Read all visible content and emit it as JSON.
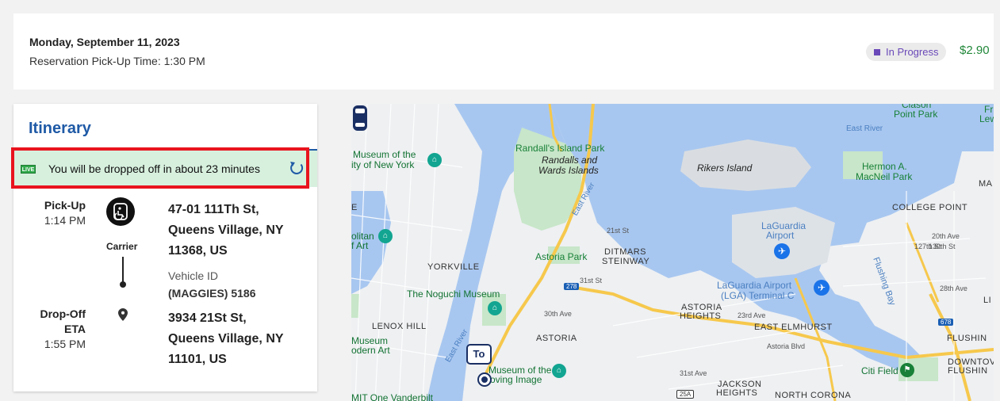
{
  "header": {
    "date": "Monday, September 11, 2023",
    "pickup_time": "Reservation Pick-Up Time: 1:30 PM",
    "status": "In Progress",
    "fare": "$2.90"
  },
  "itinerary": {
    "title": "Itinerary",
    "live_tag": "LIVE",
    "live_message": "You will be dropped off in about 23 minutes",
    "pickup": {
      "label": "Pick-Up",
      "time": "1:14 PM",
      "carrier": "Carrier",
      "address": [
        "47-01 111Th St,",
        "Queens Village, NY",
        "11368, US"
      ],
      "vehicle_id_label": "Vehicle ID",
      "vehicle_id": "(MAGGIES) 5186"
    },
    "dropoff": {
      "label": "Drop-Off",
      "eta_label": "ETA",
      "time": "1:55 PM",
      "address": [
        "3934 21St St,",
        "Queens Village, NY",
        "11101, US"
      ]
    }
  },
  "map": {
    "labels": {
      "randalls_park": "Randall's Island Park",
      "randalls_islands_1": "Randalls and",
      "randalls_islands_2": "Wards Islands",
      "rikers": "Rikers Island",
      "hermon_1": "Hermon A.",
      "hermon_2": "MacNeil Park",
      "clason_1": "Clason",
      "clason_2": "Point Park",
      "east_river_top": "East River",
      "east_river_mid": "East River",
      "east_river_low": "East River",
      "college_point": "COLLEGE POINT",
      "laguardia_1": "LaGuardia",
      "laguardia_2": "Airport",
      "lga_terminal_1": "LaGuardia Airport",
      "lga_terminal_2": "(LGA) Terminal C",
      "flushing_bay": "Flushing Bay",
      "museum_ny_1": "Museum of the",
      "museum_ny_2": "ity of New York",
      "met_1": "olitan",
      "met_2": "f Art",
      "yorkville": "YORKVILLE",
      "astoria_park": "Astoria Park",
      "ditmars_1": "DITMARS",
      "ditmars_2": "STEINWAY",
      "noguchi": "The Noguchi Museum",
      "astoria_heights_1": "ASTORIA",
      "astoria_heights_2": "HEIGHTS",
      "east_elmhurst": "EAST ELMHURST",
      "lenox_hill": "LENOX HILL",
      "astoria": "ASTORIA",
      "museum_modern_1": "Museum",
      "museum_modern_2": "odern Art",
      "museum_moving_1": "Museum of the",
      "museum_moving_2": "oving Image",
      "citi_field": "Citi Field",
      "jackson_heights_1": "JACKSON",
      "jackson_heights_2": "HEIGHTS",
      "north_corona": "NORTH CORONA",
      "flushing": "FLUSHIN",
      "downtown_flushing_1": "DOWNTOV",
      "downtown_flushing_2": "FLUSHIN",
      "one_vanderbilt": "MIT One Vanderbilt",
      "ma": "MA",
      "li": "LI",
      "fr": "Fr",
      "lew": "Lew",
      "e": "E",
      "astoria_blvd": "Astoria Blvd",
      "ave_20th": "20th Ave",
      "ave_28th": "28th Ave",
      "ave_23rd": "23rd Ave",
      "ave_31st": "31st Ave",
      "ave_30th": "30th Ave",
      "st_21st": "21st St",
      "st_31st": "31st St",
      "st_127th": "127th St",
      "st_130th": "130th St",
      "route_278": "278",
      "route_678": "678",
      "route_25a": "25A",
      "to_label": "To"
    }
  }
}
